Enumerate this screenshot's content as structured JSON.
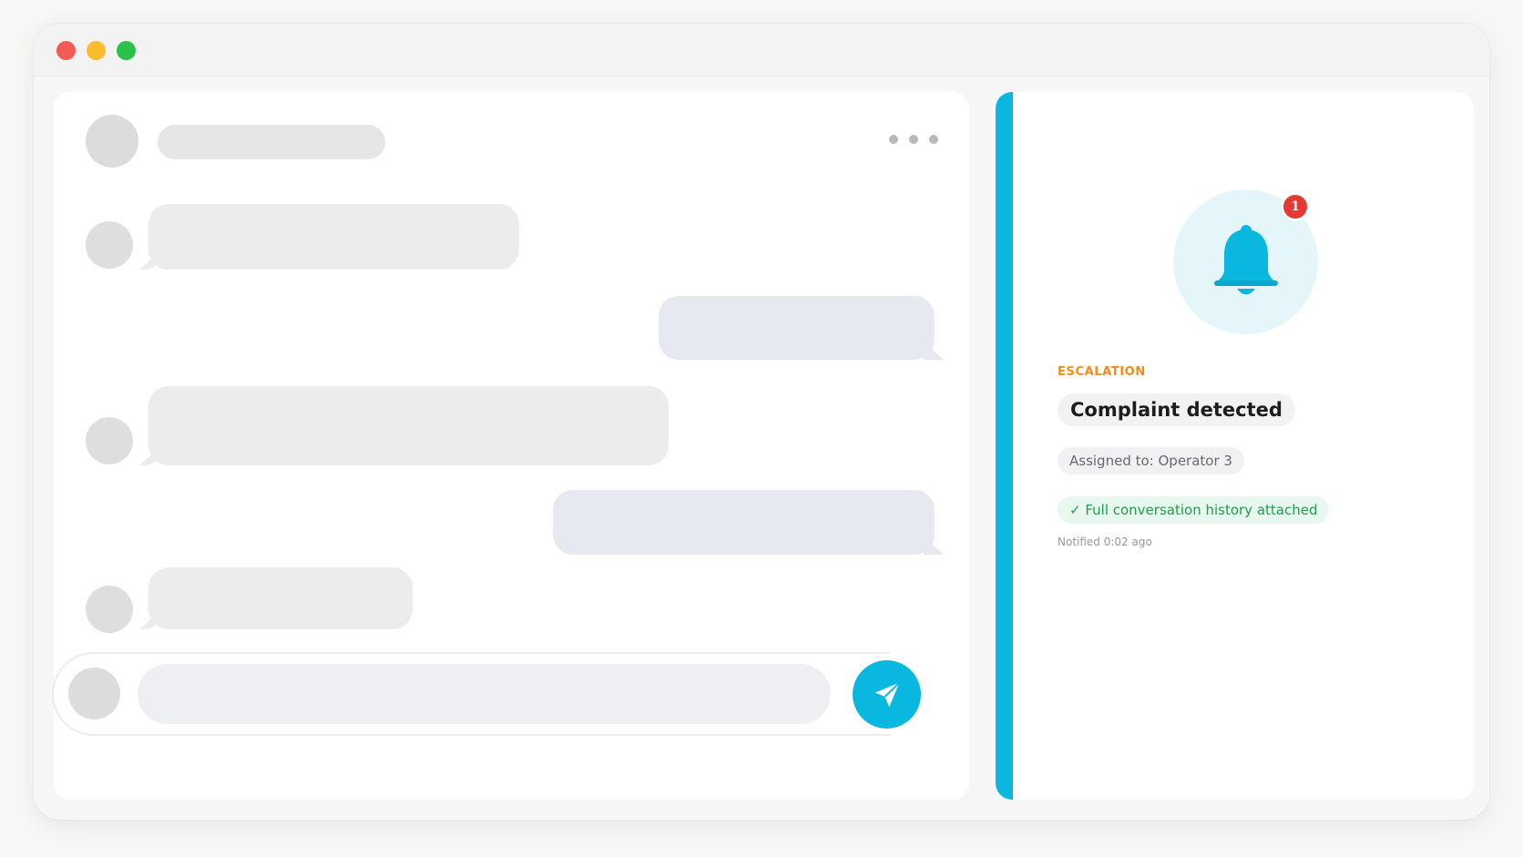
{
  "window": {
    "controls": [
      "close",
      "minimize",
      "maximize"
    ]
  },
  "chat": {
    "menu_icon": "more-horizontal-icon",
    "send_icon": "paper-plane-icon"
  },
  "notification": {
    "icon": "bell-icon",
    "badge_count": "1",
    "category": "ESCALATION",
    "title": "Complaint detected",
    "assigned": "Assigned to: Operator 3",
    "history": "✓ Full conversation history attached",
    "timestamp": "Notified 0:02 ago"
  },
  "colors": {
    "accent": "#0ab8df",
    "category": "#f28c18",
    "success": "#1e9c4c",
    "badge": "#e53935"
  }
}
